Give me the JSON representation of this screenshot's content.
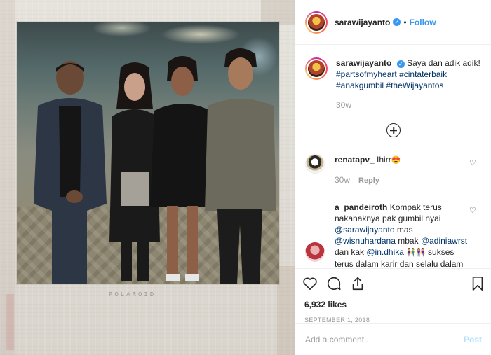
{
  "post": {
    "username": "sarawijayanto",
    "follow_label": "Follow",
    "dot": "•"
  },
  "caption": {
    "username": "sarawijayanto",
    "text": "Saya dan adik adik!",
    "hashtags": [
      "#partsofmyheart",
      "#cintaterbaik",
      "#anakgumbil",
      "#theWijayantos"
    ],
    "time": "30w"
  },
  "comments": [
    {
      "username": "renatapv_",
      "text": "Ihirr",
      "emoji": "😍",
      "time": "30w",
      "reply_label": "Reply"
    },
    {
      "username": "a_pandeiroth",
      "text_1": "Kompak terus nakanaknya pak gumbil nyai",
      "mention_1": "@sarawijayanto",
      "text_2": "mas",
      "mention_2": "@wisnuhardana",
      "text_3": "mbak",
      "mention_3": "@adiniawrst",
      "text_4": "dan kak",
      "mention_4": "@in.dhika",
      "emoji": "👫👭",
      "text_5": "sukses terus dalam karir dan selalu dalam lindungan"
    }
  ],
  "actions": {
    "likes": "6,932 likes",
    "date": "SEPTEMBER 1, 2018"
  },
  "add_comment": {
    "placeholder": "Add a comment...",
    "post_label": "Post"
  },
  "photo": {
    "frame_label": "POLAROID"
  },
  "colors": {
    "link_blue": "#3897f0",
    "hashtag": "#003569",
    "muted": "#999999",
    "post_disabled": "#b2dffc"
  }
}
